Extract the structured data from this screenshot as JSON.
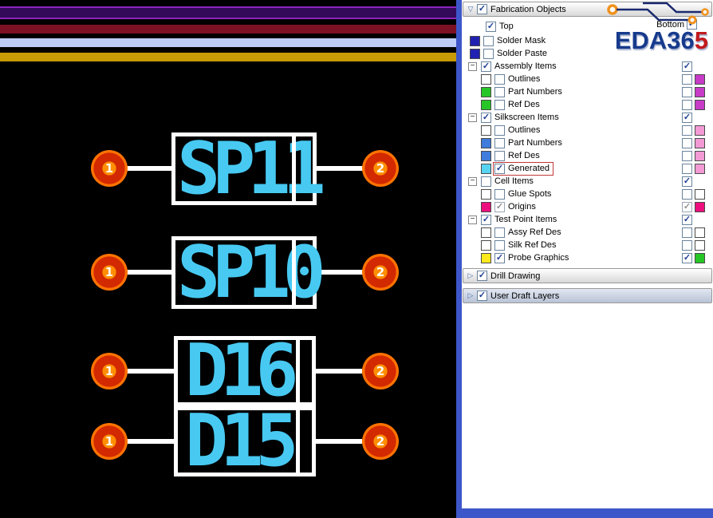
{
  "canvas": {
    "stripes": [
      "#33095a",
      "#7d1124",
      "#bdcdf7",
      "#c79a06"
    ],
    "text_color": "#47c9f2",
    "pad_color": "#ff7300",
    "components": [
      {
        "ref": "SP11",
        "pad_left": "1",
        "pad_right": "2"
      },
      {
        "ref": "SP10",
        "pad_left": "1",
        "pad_right": "2"
      },
      {
        "ref": "D16",
        "pad_left": "1",
        "pad_right": "2"
      },
      {
        "ref": "D15",
        "pad_left": "1",
        "pad_right": "2"
      }
    ]
  },
  "panel": {
    "fab_header": {
      "label": "Fabrication Objects",
      "check": "✓"
    },
    "top_row": {
      "label": "Top",
      "check": "✓"
    },
    "bottom": {
      "label": "Bottom",
      "check": "✓"
    },
    "logo": {
      "blue": "EDA36",
      "red": "5"
    },
    "rows": [
      {
        "label": "Solder Mask",
        "check": "",
        "swatch": "#2121b2"
      },
      {
        "label": "Solder Paste",
        "check": "",
        "swatch": "#2121b2"
      },
      {
        "label": "Assembly Items",
        "check": "✓",
        "exp": "−",
        "right_check": "✓"
      },
      {
        "label": "Outlines",
        "check": "",
        "swatch": "#ffffff",
        "right_check": "",
        "right_swatch": "#c73bc7"
      },
      {
        "label": "Part Numbers",
        "check": "",
        "swatch": "#27c627",
        "right_check": "",
        "right_swatch": "#c73bc7"
      },
      {
        "label": "Ref Des",
        "check": "",
        "swatch": "#27c627",
        "right_check": "",
        "right_swatch": "#c73bc7"
      },
      {
        "label": "Silkscreen Items",
        "check": "✓",
        "exp": "−",
        "right_check": "✓"
      },
      {
        "label": "Outlines",
        "check": "",
        "swatch": "#ffffff",
        "right_check": "",
        "right_swatch": "#f39ad5"
      },
      {
        "label": "Part Numbers",
        "check": "",
        "swatch": "#3f7cdb",
        "right_check": "",
        "right_swatch": "#f39ad5"
      },
      {
        "label": "Ref Des",
        "check": "",
        "swatch": "#3f7cdb",
        "right_check": "",
        "right_swatch": "#f39ad5"
      },
      {
        "label": "Generated",
        "check": "✓",
        "swatch": "#57d3f2",
        "right_check": "",
        "right_swatch": "#f39ad5"
      },
      {
        "label": "Cell Items",
        "check": "",
        "exp": "−",
        "right_check": "✓"
      },
      {
        "label": "Glue Spots",
        "check": "",
        "swatch": "#ffffff",
        "right_check": "",
        "right_swatch": "#ffffff"
      },
      {
        "label": "Origins",
        "check": "✓",
        "swatch": "#ed0f7e",
        "right_check": "✓",
        "right_swatch": "#ed0f7e"
      },
      {
        "label": "Test Point Items",
        "check": "✓",
        "exp": "−",
        "right_check": "✓"
      },
      {
        "label": "Assy Ref Des",
        "check": "",
        "swatch": "#ffffff",
        "right_check": "",
        "right_swatch": "#ffffff"
      },
      {
        "label": "Silk Ref Des",
        "check": "",
        "swatch": "#ffffff",
        "right_check": "",
        "right_swatch": "#ffffff"
      },
      {
        "label": "Probe Graphics",
        "check": "✓",
        "swatch": "#ffe91c",
        "right_check": "✓",
        "right_swatch": "#27c627"
      }
    ],
    "drill_header": {
      "label": "Drill Drawing",
      "check": "✓"
    },
    "user_draft_header": {
      "label": "User Draft Layers",
      "check": "✓"
    }
  }
}
